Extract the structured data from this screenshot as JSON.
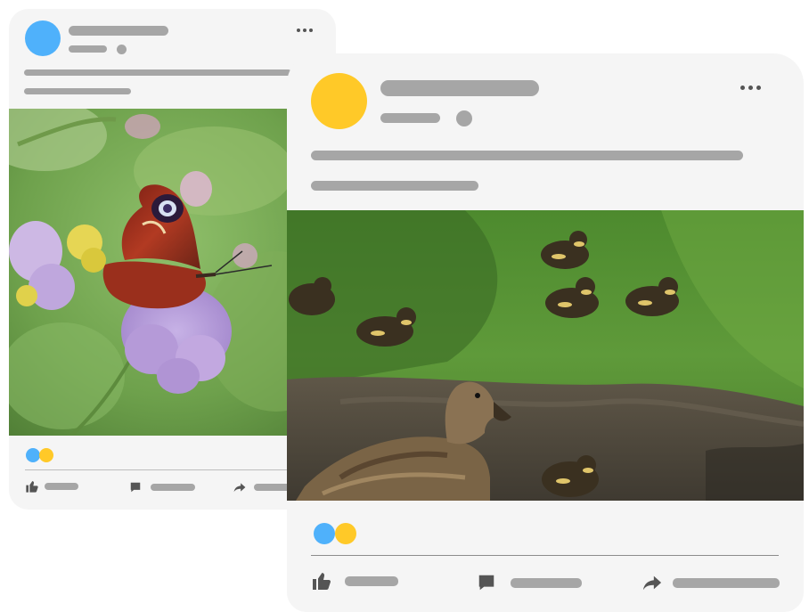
{
  "colors": {
    "card_bg": "#f5f5f5",
    "placeholder": "#a6a6a6",
    "icon": "#555555",
    "avatar_back": "#4fb1fb",
    "avatar_front": "#ffc928",
    "reaction_blue": "#4fb1fb",
    "reaction_yellow": "#ffc928"
  },
  "back_post": {
    "avatar_icon": "avatar-circle",
    "photo_subject": "butterfly-on-flower",
    "actions": [
      "like-icon",
      "comment-icon",
      "share-icon"
    ]
  },
  "front_post": {
    "avatar_icon": "avatar-circle",
    "photo_subject": "duck-with-ducklings",
    "actions": [
      "like-icon",
      "comment-icon",
      "share-icon"
    ]
  }
}
